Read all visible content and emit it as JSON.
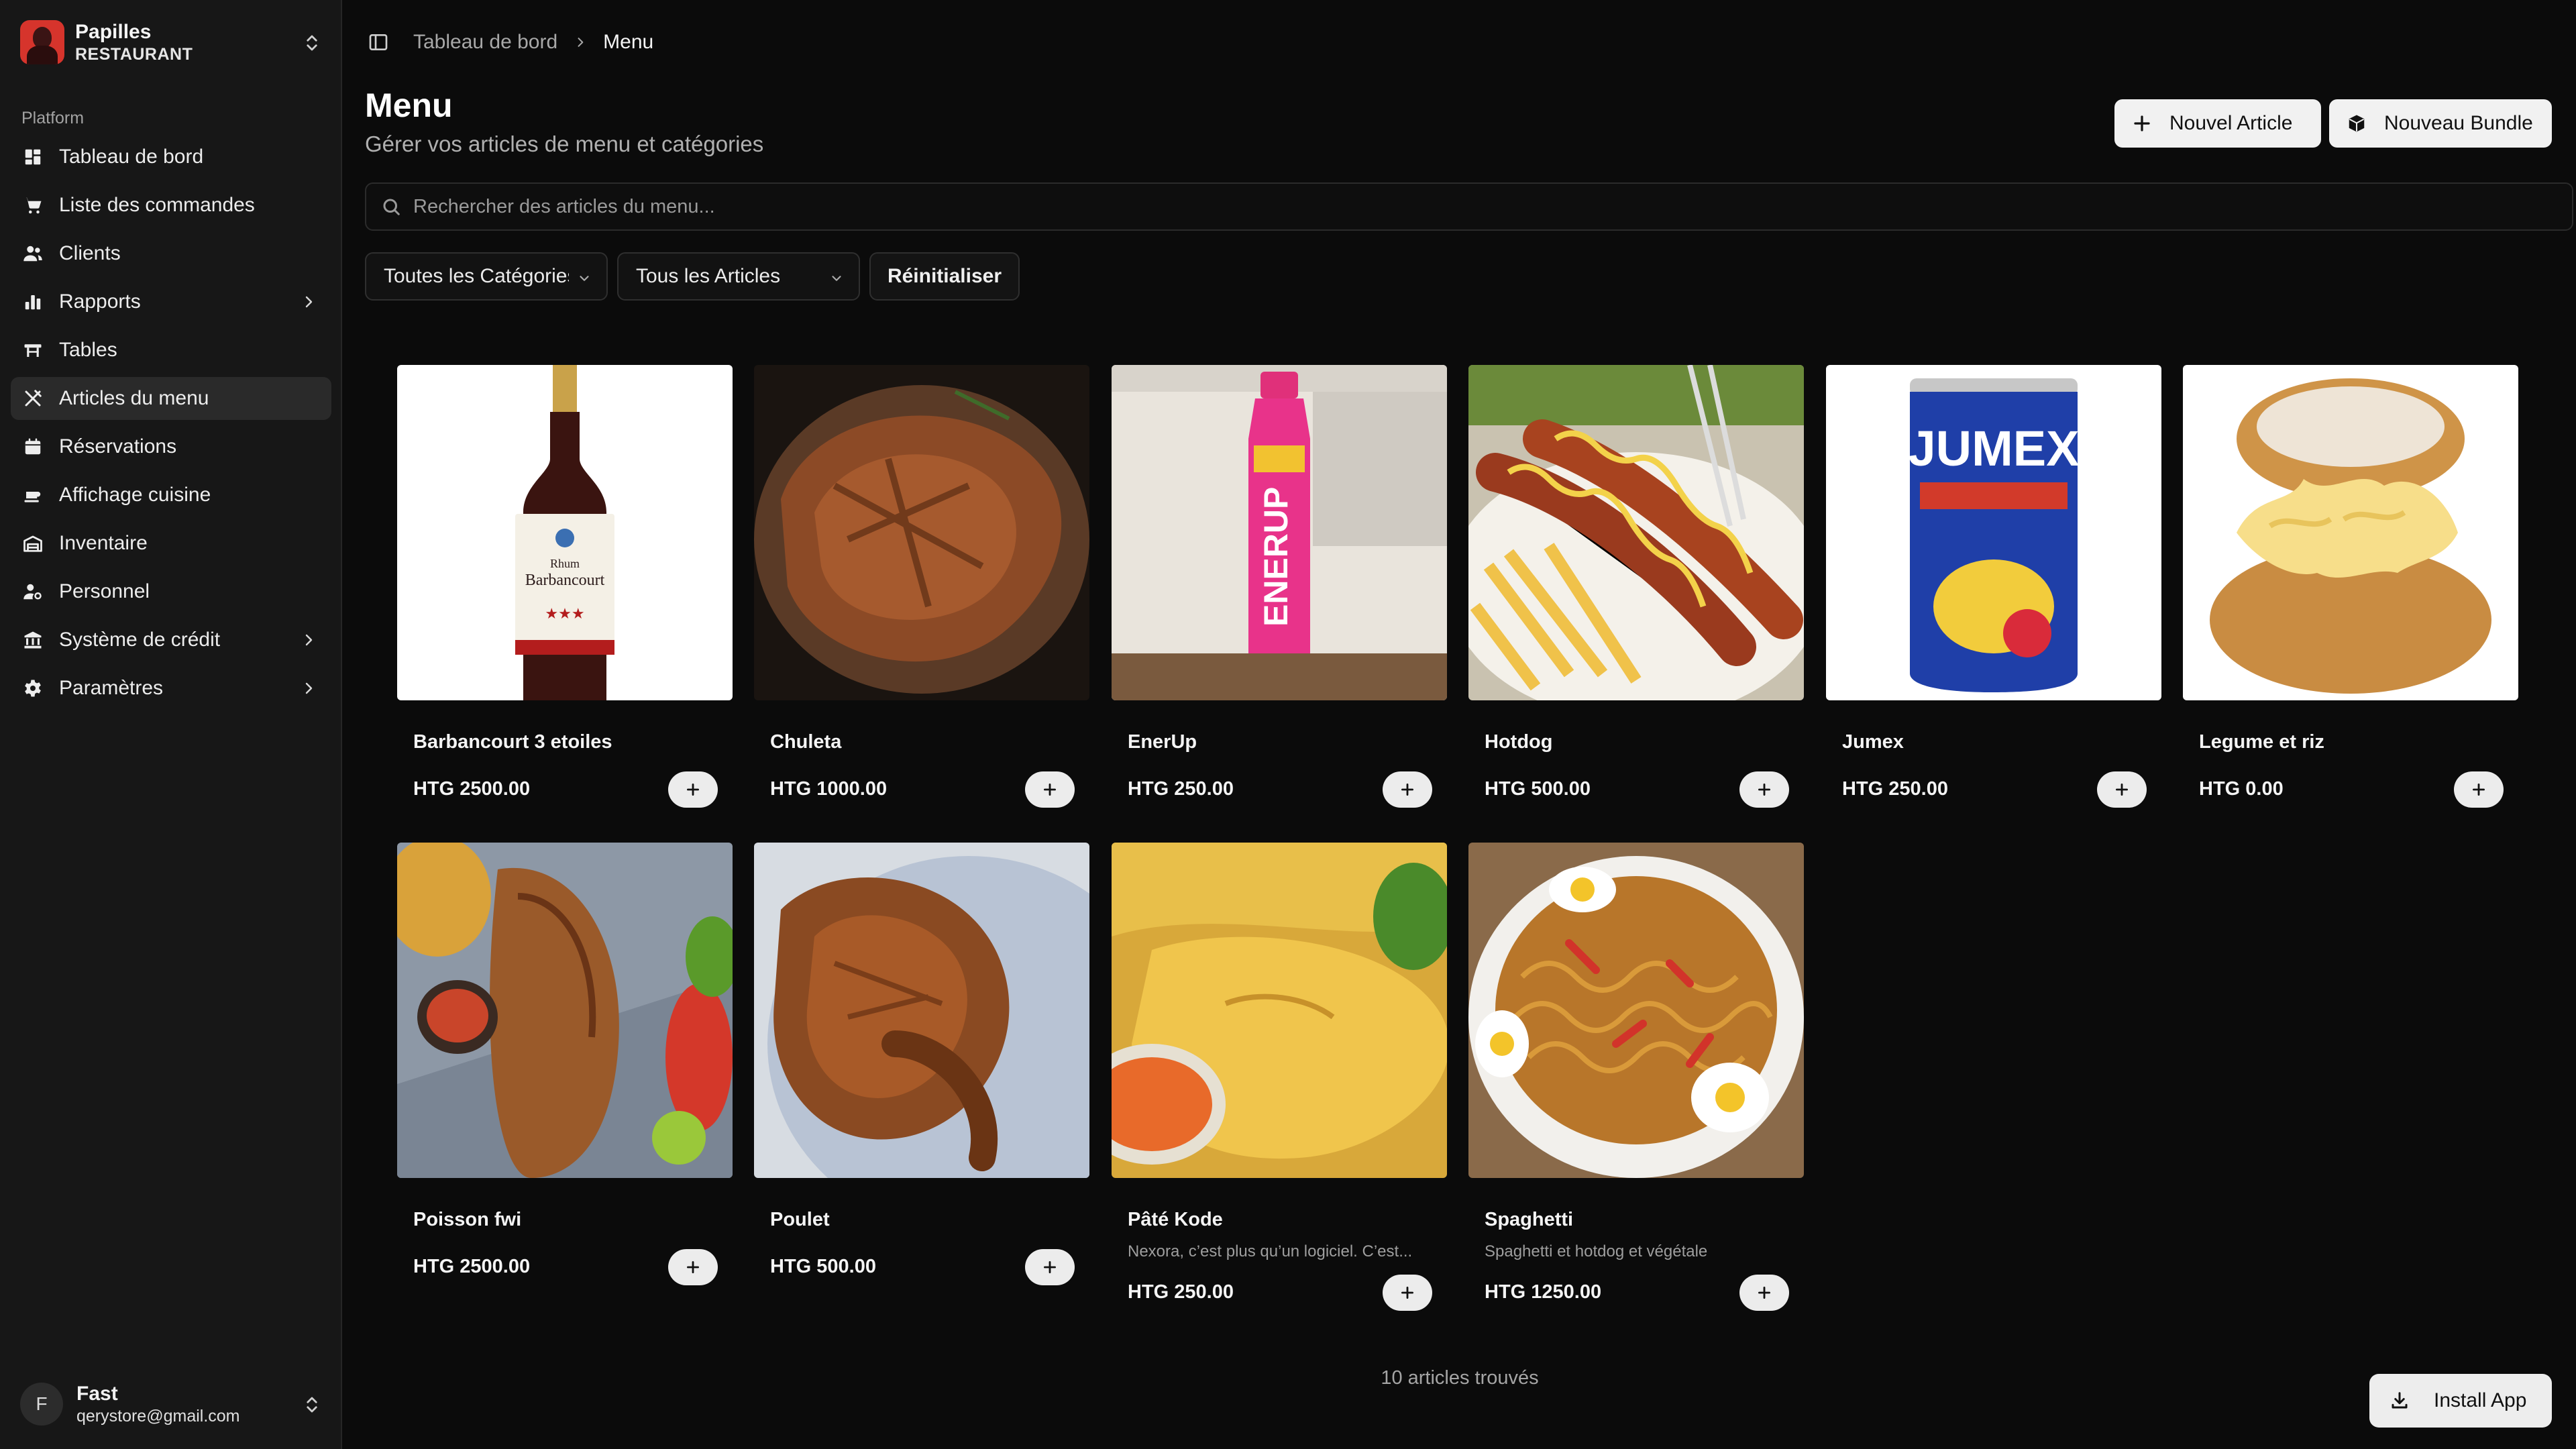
{
  "app": {
    "name": "Papilles",
    "subtitle": "RESTAURANT"
  },
  "sidebar": {
    "section_label": "Platform",
    "items": [
      {
        "label": "Tableau de bord",
        "icon": "dashboard-icon",
        "has_submenu": false,
        "active": false
      },
      {
        "label": "Liste des commandes",
        "icon": "cart-icon",
        "has_submenu": false,
        "active": false
      },
      {
        "label": "Clients",
        "icon": "users-icon",
        "has_submenu": false,
        "active": false
      },
      {
        "label": "Rapports",
        "icon": "bar-chart-icon",
        "has_submenu": true,
        "active": false
      },
      {
        "label": "Tables",
        "icon": "table-icon",
        "has_submenu": false,
        "active": false
      },
      {
        "label": "Articles du menu",
        "icon": "utensils-icon",
        "has_submenu": false,
        "active": true
      },
      {
        "label": "Réservations",
        "icon": "calendar-icon",
        "has_submenu": false,
        "active": false
      },
      {
        "label": "Affichage cuisine",
        "icon": "chef-hat-icon",
        "has_submenu": false,
        "active": false
      },
      {
        "label": "Inventaire",
        "icon": "warehouse-icon",
        "has_submenu": false,
        "active": false
      },
      {
        "label": "Personnel",
        "icon": "user-cog-icon",
        "has_submenu": false,
        "active": false
      },
      {
        "label": "Système de crédit",
        "icon": "bank-icon",
        "has_submenu": true,
        "active": false
      },
      {
        "label": "Paramètres",
        "icon": "gear-icon",
        "has_submenu": true,
        "active": false
      }
    ]
  },
  "user": {
    "initial": "F",
    "name": "Fast",
    "email": "qerystore@gmail.com"
  },
  "breadcrumb": {
    "parent": "Tableau de bord",
    "current": "Menu"
  },
  "header": {
    "title": "Menu",
    "subtitle": "Gérer vos articles de menu et catégories",
    "new_article_label": "Nouvel Article",
    "new_bundle_label": "Nouveau Bundle"
  },
  "search": {
    "placeholder": "Rechercher des articles du menu...",
    "value": ""
  },
  "filters": {
    "category_selected": "Toutes les Catégories",
    "items_selected": "Tous les Articles",
    "reset_label": "Réinitialiser"
  },
  "items": [
    {
      "name": "Barbancourt 3 etoiles",
      "price": "HTG 2500.00",
      "description": "",
      "image": "rum-bottle"
    },
    {
      "name": "Chuleta",
      "price": "HTG 1000.00",
      "description": "",
      "image": "grilled-pork-chop"
    },
    {
      "name": "EnerUp",
      "price": "HTG 250.00",
      "description": "",
      "image": "energy-drink-bottle"
    },
    {
      "name": "Hotdog",
      "price": "HTG 500.00",
      "description": "",
      "image": "hotdogs-fries"
    },
    {
      "name": "Jumex",
      "price": "HTG 250.00",
      "description": "",
      "image": "nectar-can"
    },
    {
      "name": "Legume et riz",
      "price": "HTG 0.00",
      "description": "",
      "image": "cream-puff"
    },
    {
      "name": "Poisson fwi",
      "price": "HTG 2500.00",
      "description": "",
      "image": "fried-fish"
    },
    {
      "name": "Poulet",
      "price": "HTG 500.00",
      "description": "",
      "image": "roast-chicken"
    },
    {
      "name": "Pâté Kode",
      "price": "HTG 250.00",
      "description": "Nexora, c’est plus qu’un logiciel. C’est...",
      "image": "fried-pastry"
    },
    {
      "name": "Spaghetti",
      "price": "HTG 1250.00",
      "description": "Spaghetti et hotdog et végétale",
      "image": "spaghetti-eggs"
    }
  ],
  "footer": {
    "count_text": "10 articles trouvés",
    "install_label": "Install App"
  },
  "colors": {
    "background": "#0b0b0b",
    "sidebar": "#171717",
    "active_nav": "#2a2a2a",
    "button_light": "#f1f1f1",
    "muted_text": "#a8a8a8"
  }
}
